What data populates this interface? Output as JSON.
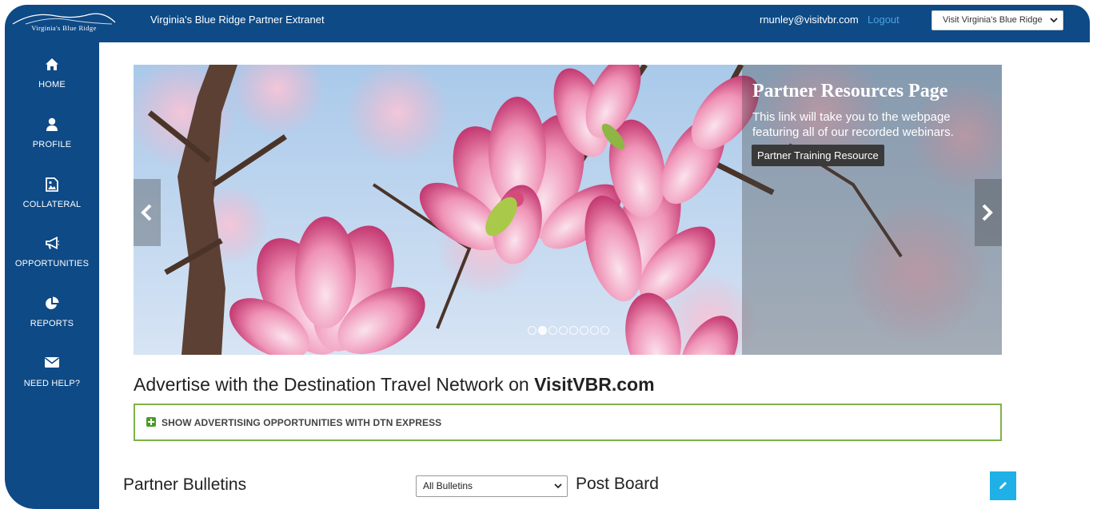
{
  "header": {
    "logo_text": "Virginia's Blue Ridge",
    "site_title": "Virginia's Blue Ridge Partner Extranet",
    "user_email": "rnunley@visitvbr.com",
    "logout_label": "Logout",
    "site_selector_value": "Visit Virginia's Blue Ridge"
  },
  "sidebar": {
    "items": [
      {
        "label": "HOME",
        "icon": "home-icon"
      },
      {
        "label": "PROFILE",
        "icon": "user-icon"
      },
      {
        "label": "COLLATERAL",
        "icon": "image-file-icon"
      },
      {
        "label": "OPPORTUNITIES",
        "icon": "bullhorn-icon"
      },
      {
        "label": "REPORTS",
        "icon": "pie-chart-icon"
      },
      {
        "label": "NEED HELP?",
        "icon": "envelope-icon"
      }
    ]
  },
  "carousel": {
    "title": "Partner Resources Page",
    "description": "This link will take you to the webpage featuring all of our recorded webinars.",
    "button_label": "Partner Training Resource",
    "slide_count": 8,
    "active_slide": 1
  },
  "advertising": {
    "heading_prefix": "Advertise with the Destination Travel Network on ",
    "heading_bold": "VisitVBR.com",
    "accordion_label": "SHOW ADVERTISING OPPORTUNITIES WITH DTN EXPRESS"
  },
  "bulletins": {
    "title": "Partner Bulletins",
    "filter_value": "All Bulletins",
    "post_board_title": "Post Board"
  },
  "colors": {
    "brand_blue": "#0e4a86",
    "link_blue": "#4aa3df",
    "accordion_green": "#7fb24a",
    "edit_button": "#1fb0e8"
  }
}
